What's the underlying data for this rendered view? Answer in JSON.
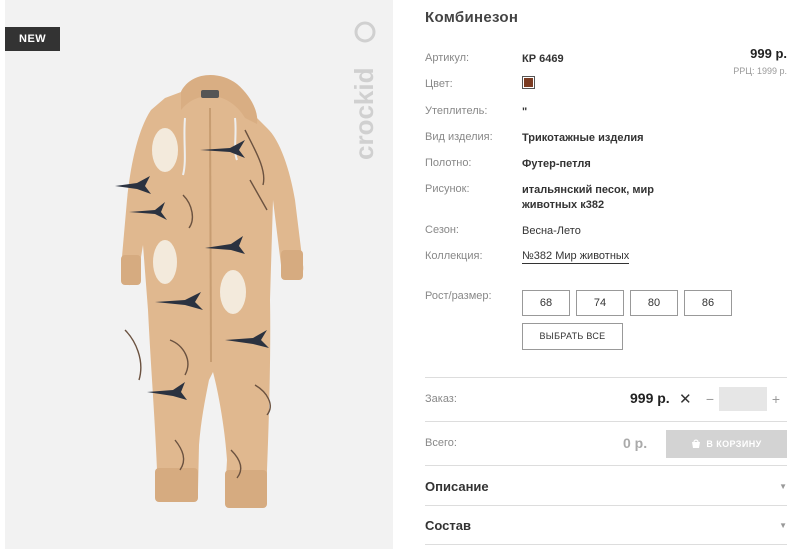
{
  "badge": "NEW",
  "brand": "crockid",
  "product": {
    "title": "Комбинезон",
    "price": "999 р.",
    "rrp": "РРЦ: 1999 р."
  },
  "specs": {
    "article": {
      "label": "Артикул:",
      "value": "КР 6469"
    },
    "color": {
      "label": "Цвет:",
      "swatch": "#7b3b22"
    },
    "insulation": {
      "label": "Утеплитель:",
      "value": "\""
    },
    "type": {
      "label": "Вид изделия:",
      "value": "Трикотажные изделия"
    },
    "fabric": {
      "label": "Полотно:",
      "value": "Футер-петля"
    },
    "pattern": {
      "label": "Рисунок:",
      "value": "итальянский песок, мир животных к382"
    },
    "season": {
      "label": "Сезон:",
      "value": "Весна-Лето"
    },
    "collection": {
      "label": "Коллекция:",
      "value": "№382 Мир животных"
    },
    "size": {
      "label": "Рост/размер:"
    }
  },
  "sizes": [
    "68",
    "74",
    "80",
    "86"
  ],
  "select_all": "ВЫБРАТЬ ВСЕ",
  "order": {
    "label": "Заказ:",
    "price": "999 р.",
    "times": "✕",
    "minus": "−",
    "plus": "+",
    "qty": ""
  },
  "total": {
    "label": "Всего:",
    "value": "0 р.",
    "cart_button": "В КОРЗИНУ"
  },
  "accordion": {
    "description": "Описание",
    "composition": "Состав"
  },
  "colors": {
    "badge_bg": "#333333",
    "photo_bg": "#f2f2f2",
    "garment": "#e0b88f",
    "cart_disabled": "#d3d3d3"
  }
}
